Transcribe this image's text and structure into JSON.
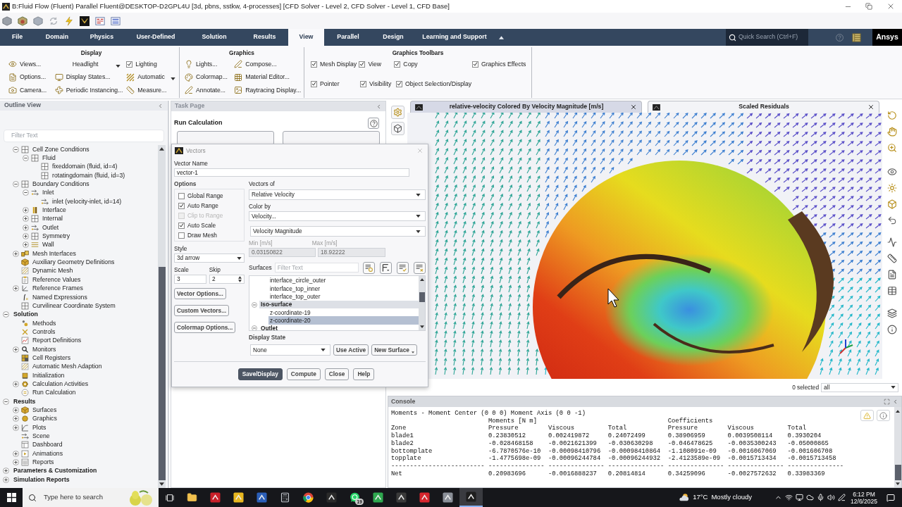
{
  "title_bar": {
    "title": "B:Fluid Flow (Fluent) Parallel Fluent@DESKTOP-D2GPL4U [3d, pbns, sstkw, 4-processes] [CFD Solver - Level 2, CFD Solver - Level 1, CFD Base]"
  },
  "menu": {
    "tabs": [
      {
        "label": "File",
        "selected": false
      },
      {
        "label": "Domain",
        "selected": false
      },
      {
        "label": "Physics",
        "selected": false
      },
      {
        "label": "User-Defined",
        "selected": false
      },
      {
        "label": "Solution",
        "selected": false
      },
      {
        "label": "Results",
        "selected": false
      },
      {
        "label": "View",
        "selected": true
      },
      {
        "label": "Parallel",
        "selected": false
      },
      {
        "label": "Design",
        "selected": false
      },
      {
        "label": "Learning and Support",
        "selected": false
      }
    ],
    "search": {
      "placeholder": "Quick Search (Ctrl+F)"
    },
    "logo": "Ansys"
  },
  "ribbon": {
    "groups": [
      {
        "title": "Display",
        "rows": [
          [
            {
              "kind": "command",
              "label": "Views..."
            },
            {
              "kind": "dropdown",
              "label": "Headlight"
            },
            {
              "kind": "checkbox",
              "label": "Lighting",
              "checked": true
            }
          ],
          [
            {
              "kind": "command",
              "label": "Options..."
            },
            {
              "kind": "command",
              "label": "Display States..."
            },
            {
              "kind": "dropdown",
              "label": "Automatic"
            }
          ],
          [
            {
              "kind": "command",
              "label": "Camera..."
            },
            {
              "kind": "command",
              "label": "Periodic Instancing..."
            },
            {
              "kind": "command",
              "label": "Measure..."
            }
          ]
        ]
      },
      {
        "title": "Graphics",
        "rows": [
          [
            {
              "kind": "command",
              "label": "Lights..."
            },
            {
              "kind": "command",
              "label": "Compose..."
            }
          ],
          [
            {
              "kind": "command",
              "label": "Colormap..."
            },
            {
              "kind": "command",
              "label": "Material Editor..."
            }
          ],
          [
            {
              "kind": "command",
              "label": "Annotate..."
            },
            {
              "kind": "command",
              "label": "Raytracing Display..."
            }
          ]
        ]
      },
      {
        "title": "Graphics Toolbars",
        "rows": [
          [
            {
              "kind": "checkbox",
              "label": "Mesh Display",
              "checked": true
            },
            {
              "kind": "checkbox",
              "label": "View",
              "checked": true
            },
            {
              "kind": "checkbox",
              "label": "Copy",
              "checked": true
            },
            {
              "kind": "checkbox",
              "label": "Graphics Effects",
              "checked": true
            }
          ],
          [
            {
              "kind": "checkbox",
              "label": "Pointer",
              "checked": true
            },
            {
              "kind": "checkbox",
              "label": "Visibility",
              "checked": true
            },
            {
              "kind": "checkbox",
              "label": "Object Selection/Display",
              "checked": true
            }
          ]
        ]
      }
    ]
  },
  "outline": {
    "title": "Outline View",
    "filter": {
      "placeholder": "Filter Text"
    },
    "tree": [
      {
        "label": "Cell Zone Conditions",
        "kind": "grid",
        "expanded": true,
        "children": [
          {
            "label": "Fluid",
            "kind": "grid",
            "expanded": true,
            "children": [
              {
                "label": "fixeddomain (fluid, id=4)",
                "kind": "grid"
              },
              {
                "label": "rotatingdomain (fluid, id=3)",
                "kind": "grid"
              }
            ]
          }
        ]
      },
      {
        "label": "Boundary Conditions",
        "kind": "grid",
        "expanded": true,
        "children": [
          {
            "label": "Inlet",
            "kind": "flow",
            "expanded": true,
            "children": [
              {
                "label": "inlet (velocity-inlet, id=14)",
                "kind": "flow"
              }
            ]
          },
          {
            "label": "Interface",
            "kind": "interface",
            "expanded": false
          },
          {
            "label": "Internal",
            "kind": "grid",
            "expanded": false
          },
          {
            "label": "Outlet",
            "kind": "flow",
            "expanded": false
          },
          {
            "label": "Symmetry",
            "kind": "grid",
            "expanded": false
          },
          {
            "label": "Wall",
            "kind": "wall",
            "expanded": false
          }
        ]
      },
      {
        "label": "Mesh Interfaces",
        "kind": "blocks",
        "expanded": false
      },
      {
        "label": "Auxiliary Geometry Definitions",
        "kind": "cube"
      },
      {
        "label": "Dynamic Mesh",
        "kind": "mesh"
      },
      {
        "label": "Reference Values",
        "kind": "clipboard"
      },
      {
        "label": "Reference Frames",
        "kind": "axes",
        "expanded": false
      },
      {
        "label": "Named Expressions",
        "kind": "function"
      },
      {
        "label": "Curvilinear Coordinate System",
        "kind": "grid"
      },
      {
        "label": "Solution",
        "kind": "section",
        "expanded": true,
        "children": [
          {
            "label": "Methods",
            "kind": "dots"
          },
          {
            "label": "Controls",
            "kind": "cross"
          },
          {
            "label": "Report Definitions",
            "kind": "chart"
          },
          {
            "label": "Monitors",
            "kind": "magnifier",
            "expanded": false
          },
          {
            "label": "Cell Registers",
            "kind": "cells"
          },
          {
            "label": "Automatic Mesh Adaption",
            "kind": "mesh"
          },
          {
            "label": "Initialization",
            "kind": "box"
          },
          {
            "label": "Calculation Activities",
            "kind": "cog",
            "expanded": false
          },
          {
            "label": "Run Calculation",
            "kind": "circle"
          }
        ]
      },
      {
        "label": "Results",
        "kind": "section",
        "expanded": true,
        "children": [
          {
            "label": "Surfaces",
            "kind": "cube",
            "expanded": false
          },
          {
            "label": "Graphics",
            "kind": "blob",
            "expanded": false
          },
          {
            "label": "Plots",
            "kind": "plot",
            "expanded": false
          },
          {
            "label": "Scene",
            "kind": "flow"
          },
          {
            "label": "Dashboard",
            "kind": "panel"
          },
          {
            "label": "Animations",
            "kind": "frame",
            "expanded": false
          },
          {
            "label": "Reports",
            "kind": "table",
            "expanded": false
          }
        ]
      },
      {
        "label": "Parameters & Customization",
        "kind": "section",
        "expanded": false
      },
      {
        "label": "Simulation Reports",
        "kind": "section",
        "expanded": false
      }
    ]
  },
  "task_page": {
    "title": "Task Page",
    "heading": "Run Calculation"
  },
  "vectors_dialog": {
    "title": "Vectors",
    "vector_name": {
      "label": "Vector Name",
      "value": "vector-1"
    },
    "options": {
      "label": "Options",
      "items": [
        {
          "label": "Global Range",
          "checked": false,
          "disabled": false
        },
        {
          "label": "Auto Range",
          "checked": true,
          "disabled": false
        },
        {
          "label": "Clip to Range",
          "checked": false,
          "disabled": true
        },
        {
          "label": "Auto Scale",
          "checked": true,
          "disabled": false
        },
        {
          "label": "Draw Mesh",
          "checked": false,
          "disabled": false
        }
      ]
    },
    "style": {
      "label": "Style",
      "value": "3d arrow"
    },
    "scale": {
      "label": "Scale",
      "value": "3"
    },
    "skip": {
      "label": "Skip",
      "value": "2"
    },
    "side_buttons": [
      "Vector Options...",
      "Custom Vectors...",
      "Colormap Options..."
    ],
    "vectors_of": {
      "label": "Vectors of",
      "value": "Relative Velocity"
    },
    "color_by": {
      "label": "Color by",
      "value": "Velocity...",
      "component": "Velocity Magnitude"
    },
    "min": {
      "label": "Min [m/s]",
      "value": "0.03150822",
      "disabled": true
    },
    "max": {
      "label": "Max [m/s]",
      "value": "18.92222",
      "disabled": true
    },
    "surfaces": {
      "label": "Surfaces",
      "filter": {
        "placeholder": "Filter Text"
      },
      "items": [
        {
          "label": "interface_circle_outer",
          "kind": "surface",
          "selected": false
        },
        {
          "label": "interface_top_inner",
          "kind": "surface",
          "selected": false
        },
        {
          "label": "interface_top_outer",
          "kind": "surface",
          "selected": false
        },
        {
          "label": "Iso-surface",
          "kind": "group",
          "expanded": true,
          "selected": true,
          "children": [
            {
              "label": "z-coordinate-19",
              "kind": "surface",
              "selected": false
            },
            {
              "label": "z-coordinate-20",
              "kind": "surface",
              "selected": true
            }
          ]
        },
        {
          "label": "Outlet",
          "kind": "group",
          "expanded": true,
          "selected": false
        }
      ]
    },
    "display_state": {
      "label": "Display State",
      "value": "None"
    },
    "state_buttons": [
      "Use Active",
      "New Surface"
    ],
    "footer_buttons": [
      {
        "label": "Save/Display",
        "primary": true
      },
      {
        "label": "Compute",
        "primary": false
      },
      {
        "label": "Close",
        "primary": false
      },
      {
        "label": "Help",
        "primary": false
      }
    ]
  },
  "graphics": {
    "tabs": [
      {
        "label": "relative-velocity Colored By Velocity Magnitude [m/s]",
        "selected": true
      },
      {
        "label": "Scaled Residuals",
        "selected": false
      }
    ],
    "selection": {
      "count": "0 selected",
      "filter": "all"
    }
  },
  "console": {
    "title": "Console",
    "heading": "Moments - Moment Center (0 0 0) Moment Axis (0 0 -1)",
    "group_headers": [
      "Moments [N m]",
      "Coefficients"
    ],
    "columns": [
      "Zone",
      "Pressure",
      "Viscous",
      "Total",
      "Pressure",
      "Viscous",
      "Total"
    ],
    "rows": [
      [
        "blade1",
        "0.23830512",
        "0.002419872",
        "0.24072499",
        "0.38906959",
        "0.0039508114",
        "0.3930204"
      ],
      [
        "blade2",
        "-0.028468158",
        "-0.0021621399",
        "-0.030630298",
        "-0.046478625",
        "-0.0035300243",
        "-0.05000865"
      ],
      [
        "bottomplate",
        "-6.7870576e-10",
        "-0.00098410796",
        "-0.00098410864",
        "-1.108091e-09",
        "-0.0016067069",
        "-0.001606708"
      ],
      [
        "topplate",
        "-1.4775698e-09",
        "-0.00096244784",
        "-0.00096244932",
        "-2.4123589e-09",
        "-0.0015713434",
        "-0.0015713458"
      ]
    ],
    "separator": [
      "-------------------------",
      "---------------",
      "---------------",
      "---------------",
      "---------------",
      "---------------",
      "---------------"
    ],
    "total": [
      "Net",
      "0.20983696",
      "-0.0016888237",
      "0.20814814",
      "0.34259096",
      "-0.0027572632",
      "0.33983369"
    ]
  },
  "taskbar": {
    "search": {
      "placeholder": "Type here to search"
    },
    "apps": [
      {
        "kind": "folder",
        "selected": false
      },
      {
        "kind": "tile",
        "color": "#c8202a",
        "selected": false
      },
      {
        "kind": "tile",
        "color": "#e8b820",
        "selected": false
      },
      {
        "kind": "tile",
        "color": "#2b5fb8",
        "selected": false
      },
      {
        "kind": "calculator",
        "selected": false
      },
      {
        "kind": "browser",
        "selected": false
      },
      {
        "kind": "tile",
        "color": "#2a2a2a",
        "selected": false
      },
      {
        "kind": "chat",
        "selected": false,
        "badge": "19"
      },
      {
        "kind": "tile",
        "color": "#2fa84f",
        "selected": false
      },
      {
        "kind": "tile",
        "color": "#3a3a3a",
        "selected": false
      },
      {
        "kind": "tile",
        "color": "#d7262e",
        "selected": false
      },
      {
        "kind": "tile",
        "color": "#8a8f98",
        "selected": false
      },
      {
        "kind": "tile",
        "color": "#1e1e1e",
        "selected": true
      }
    ],
    "weather": {
      "temperature": "17°C",
      "condition": "Mostly cloudy"
    },
    "clock": {
      "time": "6:12 PM",
      "date": "12/6/2025"
    }
  }
}
